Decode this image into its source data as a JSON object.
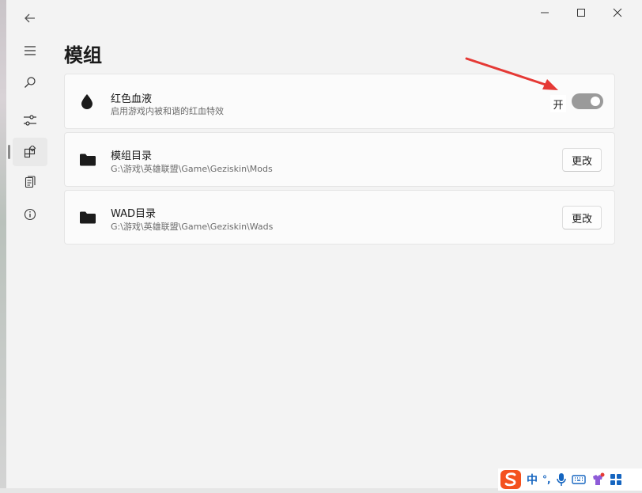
{
  "page": {
    "title": "模组"
  },
  "cards": [
    {
      "title": "红色血液",
      "subtitle": "启用游戏内被和谐的红血特效",
      "icon": "drop-icon",
      "toggle": {
        "label": "开",
        "on": true
      }
    },
    {
      "title": "模组目录",
      "subtitle": "G:\\游戏\\英雄联盟\\Game\\Geziskin\\Mods",
      "icon": "folder-icon",
      "button_label": "更改"
    },
    {
      "title": "WAD目录",
      "subtitle": "G:\\游戏\\英雄联盟\\Game\\Geziskin\\Wads",
      "icon": "folder-icon",
      "button_label": "更改"
    }
  ],
  "nav": {
    "items": [
      "back-icon",
      "menu-icon",
      "search-icon",
      "settings-sliders-icon",
      "mods-icon",
      "documents-icon",
      "info-icon"
    ],
    "selected": "mods-icon"
  },
  "tray": {
    "ime_char": "中",
    "punct": "°,"
  },
  "colors": {
    "accent_arrow": "#e53935",
    "toggle_track": "#9a9a9a",
    "background": "#f3f3f3",
    "card": "#fbfbfb"
  }
}
